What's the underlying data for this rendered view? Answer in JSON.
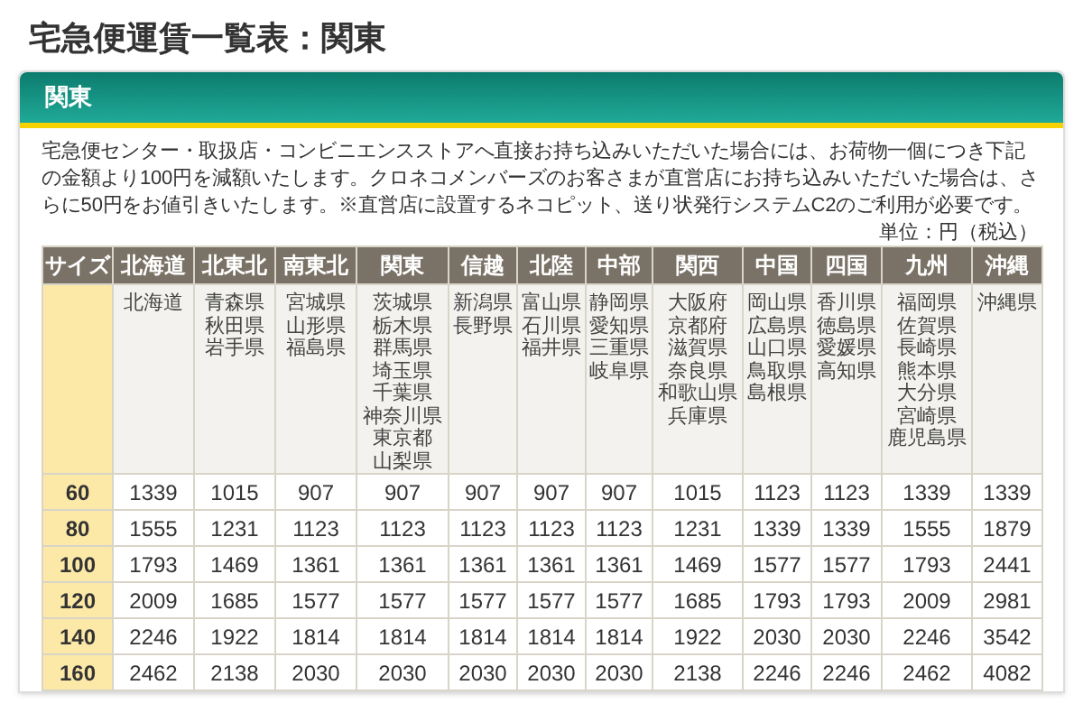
{
  "page_title": "宅急便運賃一覧表：関東",
  "panel": {
    "title": "関東",
    "note": "宅急便センター・取扱店・コンビニエンスストアへ直接お持ち込みいただいた場合には、お荷物一個につき下記の金額より100円を減額いたします。クロネコメンバーズのお客さまが直営店にお持ち込みいただいた場合は、さらに50円をお値引きいたします。※直営店に設置するネコピット、送り状発行システムC2のご利用が必要です。",
    "unit": "単位：円（税込）"
  },
  "table": {
    "size_header": "サイズ",
    "columns": [
      {
        "label": "北海道",
        "prefectures": [
          "北海道"
        ]
      },
      {
        "label": "北東北",
        "prefectures": [
          "青森県",
          "秋田県",
          "岩手県"
        ]
      },
      {
        "label": "南東北",
        "prefectures": [
          "宮城県",
          "山形県",
          "福島県"
        ]
      },
      {
        "label": "関東",
        "prefectures": [
          "茨城県",
          "栃木県",
          "群馬県",
          "埼玉県",
          "千葉県",
          "神奈川県",
          "東京都",
          "山梨県"
        ]
      },
      {
        "label": "信越",
        "prefectures": [
          "新潟県",
          "長野県"
        ]
      },
      {
        "label": "北陸",
        "prefectures": [
          "富山県",
          "石川県",
          "福井県"
        ]
      },
      {
        "label": "中部",
        "prefectures": [
          "静岡県",
          "愛知県",
          "三重県",
          "岐阜県"
        ]
      },
      {
        "label": "関西",
        "prefectures": [
          "大阪府",
          "京都府",
          "滋賀県",
          "奈良県",
          "和歌山県",
          "兵庫県"
        ]
      },
      {
        "label": "中国",
        "prefectures": [
          "岡山県",
          "広島県",
          "山口県",
          "鳥取県",
          "島根県"
        ]
      },
      {
        "label": "四国",
        "prefectures": [
          "香川県",
          "徳島県",
          "愛媛県",
          "高知県"
        ]
      },
      {
        "label": "九州",
        "prefectures": [
          "福岡県",
          "佐賀県",
          "長崎県",
          "熊本県",
          "大分県",
          "宮崎県",
          "鹿児島県"
        ]
      },
      {
        "label": "沖縄",
        "prefectures": [
          "沖縄県"
        ]
      }
    ],
    "rows": [
      {
        "size": "60",
        "prices": [
          "1339",
          "1015",
          "907",
          "907",
          "907",
          "907",
          "907",
          "1015",
          "1123",
          "1123",
          "1339",
          "1339"
        ]
      },
      {
        "size": "80",
        "prices": [
          "1555",
          "1231",
          "1123",
          "1123",
          "1123",
          "1123",
          "1123",
          "1231",
          "1339",
          "1339",
          "1555",
          "1879"
        ]
      },
      {
        "size": "100",
        "prices": [
          "1793",
          "1469",
          "1361",
          "1361",
          "1361",
          "1361",
          "1361",
          "1469",
          "1577",
          "1577",
          "1793",
          "2441"
        ]
      },
      {
        "size": "120",
        "prices": [
          "2009",
          "1685",
          "1577",
          "1577",
          "1577",
          "1577",
          "1577",
          "1685",
          "1793",
          "1793",
          "2009",
          "2981"
        ]
      },
      {
        "size": "140",
        "prices": [
          "2246",
          "1922",
          "1814",
          "1814",
          "1814",
          "1814",
          "1814",
          "1922",
          "2030",
          "2030",
          "2246",
          "3542"
        ]
      },
      {
        "size": "160",
        "prices": [
          "2462",
          "2138",
          "2030",
          "2030",
          "2030",
          "2030",
          "2030",
          "2138",
          "2246",
          "2246",
          "2462",
          "4082"
        ]
      }
    ]
  }
}
